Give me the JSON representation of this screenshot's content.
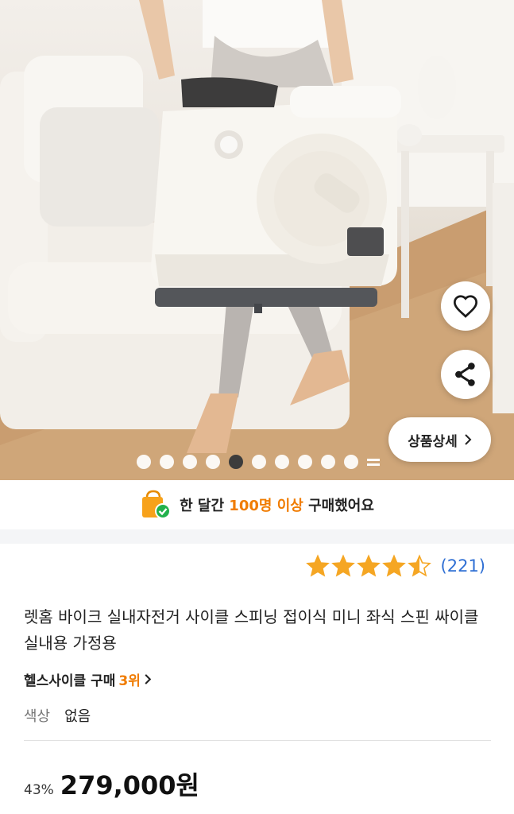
{
  "hero": {
    "detail_button_label": "상품상세",
    "carousel": {
      "total": 10,
      "active_index": 4
    }
  },
  "banner": {
    "prefix": "한 달간 ",
    "highlight": "100명 이상",
    "suffix": " 구매했어요"
  },
  "product": {
    "rating": 4.5,
    "review_count": "(221)",
    "title": "렛홈 바이크 실내자전거 사이클 스피닝 접이식 미니 좌식 스핀 싸이클 실내용 가정용",
    "rank_prefix": "헬스사이클 구매 ",
    "rank_value": "3위",
    "option_label": "색상",
    "option_value": "없음",
    "discount": "43%",
    "price": "279,000원"
  },
  "colors": {
    "accent": "#f07c00",
    "star": "#f5a623",
    "link": "#2f6fd4",
    "check": "#22b14c"
  }
}
